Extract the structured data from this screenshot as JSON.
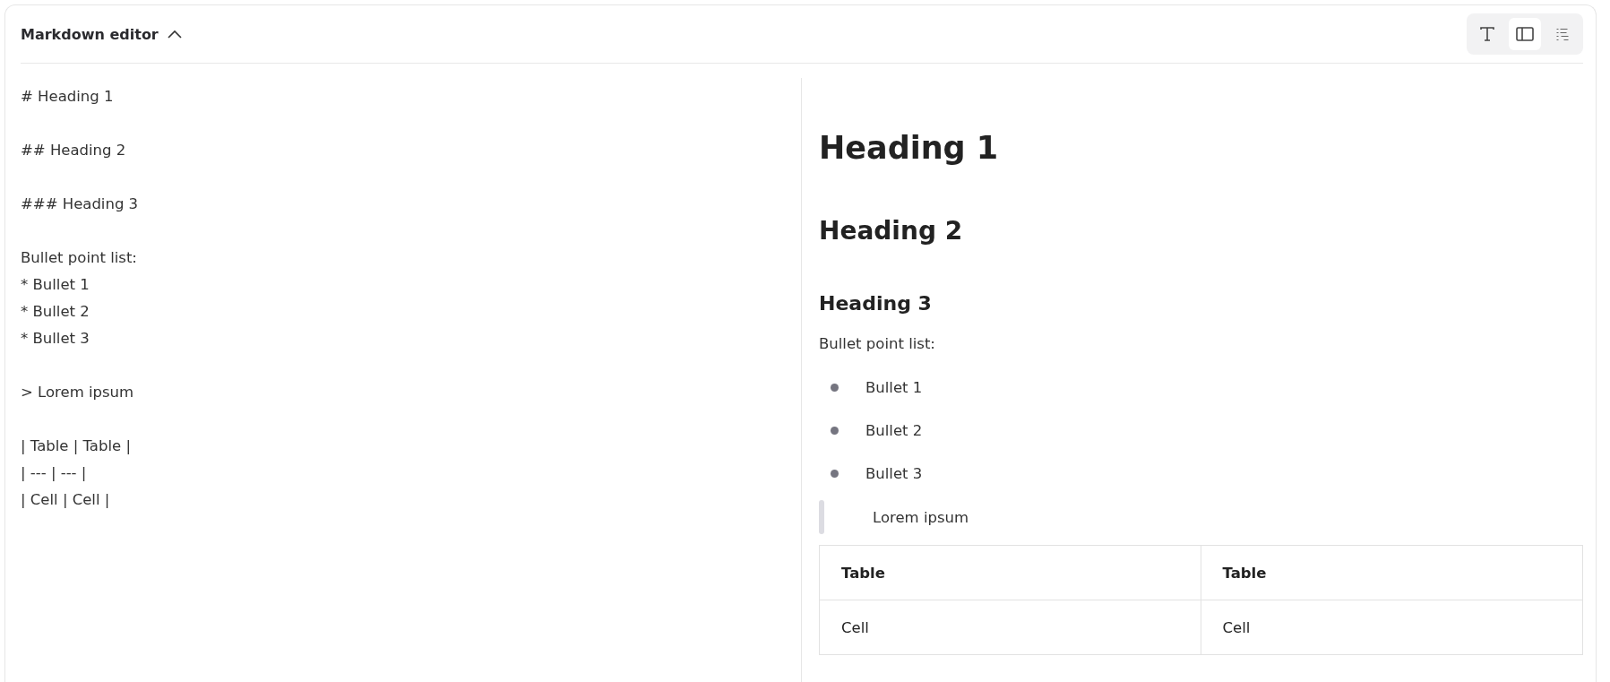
{
  "header": {
    "title": "Markdown editor",
    "expanded": true
  },
  "view_modes": [
    {
      "kind": "text",
      "selected": false
    },
    {
      "kind": "split",
      "selected": true
    },
    {
      "kind": "code",
      "selected": false
    }
  ],
  "editor": {
    "blocks": [
      [
        "# Heading 1"
      ],
      [
        "## Heading 2"
      ],
      [
        "### Heading 3"
      ],
      [
        "Bullet point list:",
        "* Bullet 1",
        "* Bullet 2",
        "* Bullet 3"
      ],
      [
        "> Lorem ipsum"
      ],
      [
        "| Table | Table |",
        "| --- | --- |",
        "| Cell | Cell |"
      ]
    ]
  },
  "preview": {
    "blocks": [
      {
        "kind": "h1",
        "text": "Heading 1"
      },
      {
        "kind": "h2",
        "text": "Heading 2"
      },
      {
        "kind": "h3",
        "text": "Heading 3"
      },
      {
        "kind": "paragraph",
        "text": "Bullet point list:"
      },
      {
        "kind": "list",
        "items": [
          "Bullet 1",
          "Bullet 2",
          "Bullet 3"
        ]
      },
      {
        "kind": "quote",
        "text": "Lorem ipsum"
      },
      {
        "kind": "table",
        "columns": [
          "Table",
          "Table"
        ],
        "rows": [
          [
            "Cell",
            "Cell"
          ]
        ]
      }
    ]
  }
}
